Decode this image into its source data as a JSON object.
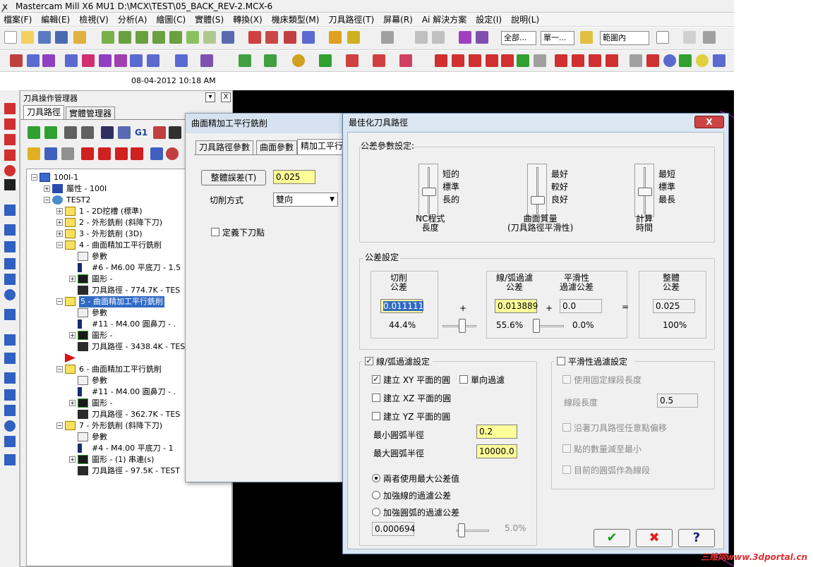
{
  "window": {
    "title": "Mastercam Mill X6 MU1  D:\\MCX\\TEST\\05_BACK_REV-2.MCX-6"
  },
  "menu": [
    "檔案(F)",
    "編輯(E)",
    "檢視(V)",
    "分析(A)",
    "繪圖(C)",
    "實體(S)",
    "轉換(X)",
    "機床類型(M)",
    "刀具路徑(T)",
    "屏幕(R)",
    "Ai 解決方案",
    "設定(I)",
    "說明(L)"
  ],
  "toolbar": {
    "selects": [
      "全部...",
      "單一...",
      "範圍內"
    ],
    "icon_labels": {
      "g1": "G1"
    }
  },
  "timestamp": "08-04-2012  10:18 AM",
  "ops_manager": {
    "title": "刀具操作管理器",
    "close": "X",
    "tabs": [
      "刀具路徑",
      "實體管理器"
    ],
    "tree": [
      {
        "indent": 0,
        "icon": "machine-group-icon",
        "label": "100I-1"
      },
      {
        "indent": 1,
        "icon": "properties-icon",
        "label": "屬性 - 100I"
      },
      {
        "indent": 1,
        "icon": "toolpath-group-icon",
        "label": "TEST2"
      },
      {
        "indent": 2,
        "icon": "folder-icon",
        "label": "1 - 2D挖槽 (標準)"
      },
      {
        "indent": 2,
        "icon": "folder-icon",
        "label": "2 - 外形銑削 (斜降下刀)"
      },
      {
        "indent": 2,
        "icon": "folder-icon",
        "label": "3 - 外形銑削 (3D)"
      },
      {
        "indent": 2,
        "icon": "folder-open-icon",
        "label": "4 - 曲面精加工平行銑削"
      },
      {
        "indent": 3,
        "icon": "parameters-icon",
        "label": "參數"
      },
      {
        "indent": 3,
        "icon": "tool-icon",
        "label": "#6 - M6.00 平底刀 - 1.5"
      },
      {
        "indent": 3,
        "icon": "geometry-icon",
        "label": "圖形 -"
      },
      {
        "indent": 3,
        "icon": "toolpath-icon",
        "label": "刀具路徑 - 774.7K - TES"
      },
      {
        "indent": 2,
        "icon": "folder-open-icon",
        "label": "5 - 曲面精加工平行銑削",
        "selected": true
      },
      {
        "indent": 3,
        "icon": "parameters-icon",
        "label": "參數"
      },
      {
        "indent": 3,
        "icon": "tool-icon",
        "label": "#11 - M4.00 圓鼻刀 - ."
      },
      {
        "indent": 3,
        "icon": "geometry-icon",
        "label": "圖形 -"
      },
      {
        "indent": 3,
        "icon": "toolpath-icon",
        "label": "刀具路徑 - 3438.4K - TES"
      },
      {
        "indent": 2,
        "icon": "insert-arrow-icon",
        "label": ""
      },
      {
        "indent": 2,
        "icon": "folder-open-icon",
        "label": "6 - 曲面精加工平行銑削"
      },
      {
        "indent": 3,
        "icon": "parameters-icon",
        "label": "參數"
      },
      {
        "indent": 3,
        "icon": "tool-icon",
        "label": "#11 - M4.00 圓鼻刀 - ."
      },
      {
        "indent": 3,
        "icon": "geometry-icon",
        "label": "圖形 -"
      },
      {
        "indent": 3,
        "icon": "toolpath-icon",
        "label": "刀具路徑 - 362.7K - TES"
      },
      {
        "indent": 2,
        "icon": "folder-open-icon",
        "label": "7 - 外形銑削 (斜降下刀)"
      },
      {
        "indent": 3,
        "icon": "parameters-icon",
        "label": "參數"
      },
      {
        "indent": 3,
        "icon": "tool-icon",
        "label": "#4 - M4.00 平底刀 - 1"
      },
      {
        "indent": 3,
        "icon": "geometry-icon",
        "label": "圖形 - (1) 串連(s)"
      },
      {
        "indent": 3,
        "icon": "toolpath-icon",
        "label": "刀具路徑 - 97.5K - TEST"
      }
    ]
  },
  "dialog_parallel": {
    "title": "曲面精加工平行銑削",
    "tabs": [
      "刀具路徑參數",
      "曲面參數",
      "精加工平行"
    ],
    "total_tolerance_button": "整體誤差(T)",
    "total_tolerance_value": "0.025",
    "cut_method_label": "切削方式",
    "cut_method_value": "雙向",
    "define_plunge_label": "定義下刀點"
  },
  "dialog_optimize": {
    "title": "最佳化刀具路徑",
    "close": "X",
    "tolerance_settings_label": "公差參數設定:",
    "sliders": [
      {
        "labels": [
          "短的",
          "標準",
          "長的"
        ],
        "caption": "NC程式\n長度",
        "level": 0.5
      },
      {
        "labels": [
          "最好",
          "較好",
          "良好"
        ],
        "caption": "曲面質量\n(刀具路徑平滑性)",
        "level": 0.7
      },
      {
        "labels": [
          "最短",
          "標準",
          "最長"
        ],
        "caption": "計算\n時間",
        "level": 0.5
      }
    ],
    "tol_section_label": "公差設定",
    "cut_tol": {
      "label": "切削\n公差",
      "value": "0.011111",
      "percent": "44.4%",
      "slider": 0.44
    },
    "arc_tol": {
      "label": "線/弧過濾\n公差",
      "value": "0.013889",
      "percent": "55.6%",
      "slider": 0.0
    },
    "plus1": "+",
    "plus2": "+",
    "equals": "=",
    "smooth_tol": {
      "label": "平滑性\n過濾公差",
      "value": "0.0",
      "percent": "0.0%"
    },
    "total_tol": {
      "label": "整體\n公差",
      "value": "0.025",
      "percent": "100%"
    },
    "arc_filter": {
      "label": "線/弧過濾設定",
      "checked": true,
      "xy": {
        "label": "建立 XY 平面的圓",
        "checked": true
      },
      "oneway": {
        "label": "單向過濾",
        "checked": false
      },
      "xz": {
        "label": "建立 XZ 平面的圓",
        "checked": false
      },
      "yz": {
        "label": "建立 YZ 平面的圓",
        "checked": false
      },
      "min_radius_label": "最小圓弧半徑",
      "min_radius": "0.2",
      "max_radius_label": "最大圓弧半徑",
      "max_radius": "10000.0",
      "radios": [
        "兩者使用最大公差值",
        "加強線的過濾公差",
        "加強圓弧的過濾公差"
      ],
      "selected_radio": 0,
      "bottom_value": "0.000694",
      "bottom_percent": "5.0%"
    },
    "smooth_filter": {
      "label": "平滑性過濾設定",
      "checked": false,
      "fixed_seg": "使用固定線段長度",
      "seg_len_label": "線段長度",
      "seg_len": "0.5",
      "any_offset": "沿著刀具路徑任意點偏移",
      "reduce_points": "點的數量減至最小",
      "arc_as_line": "目前的圓弧作為線段"
    },
    "buttons": {
      "ok": "✔",
      "cancel": "✖",
      "help": "?"
    }
  },
  "watermark": "三维网www.3dportal.cn",
  "colors": {
    "accent": "#316ac5",
    "yellow_input": "#ffff99",
    "cancel_red": "#e02020",
    "ok_green": "#1a9a1a"
  }
}
